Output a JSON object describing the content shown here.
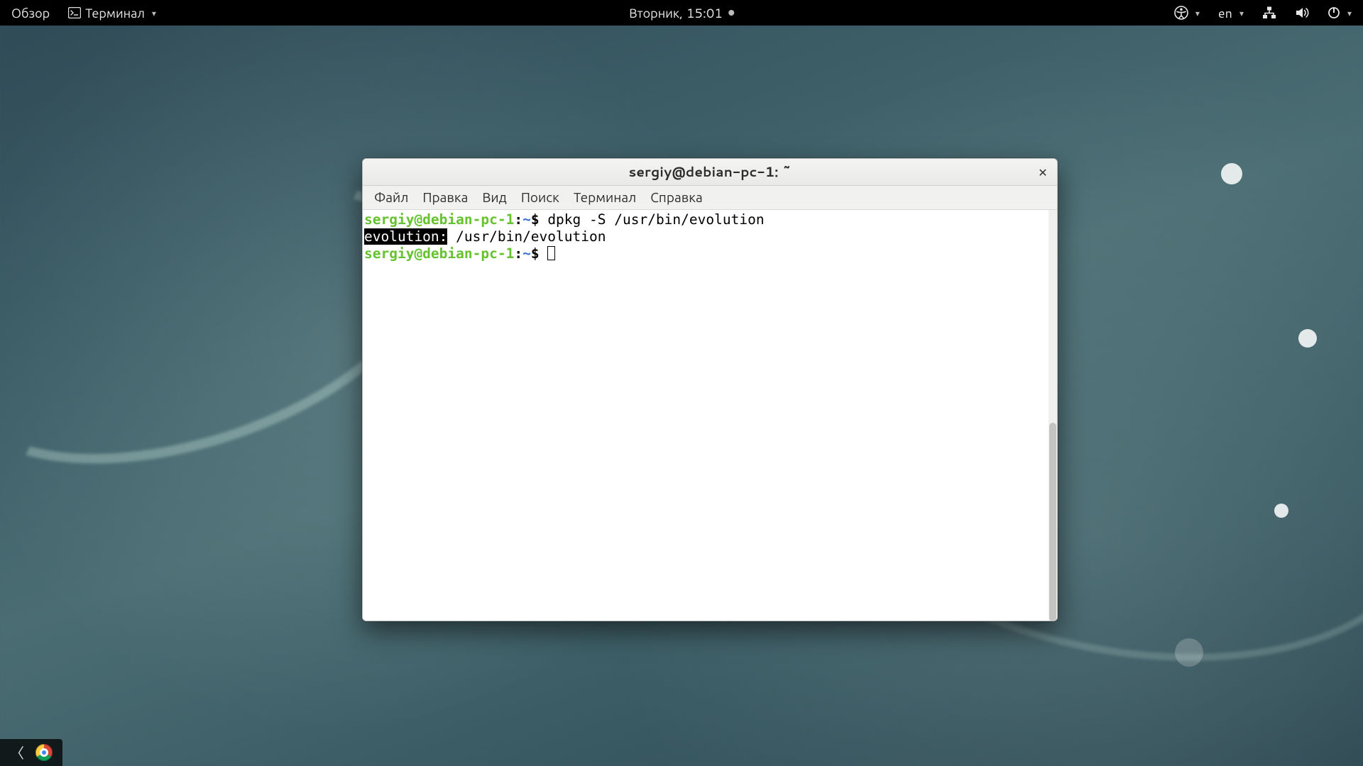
{
  "topbar": {
    "activities": "Обзор",
    "app_menu": "Терминал",
    "clock": "Вторник, 15:01",
    "lang": "en"
  },
  "window": {
    "title": "sergiy@debian-pc-1: ~",
    "menus": [
      "Файл",
      "Правка",
      "Вид",
      "Поиск",
      "Терминал",
      "Справка"
    ]
  },
  "terminal": {
    "prompt_userhost": "sergiy@debian-pc-1",
    "prompt_sep": ":",
    "prompt_path": "~",
    "prompt_symbol": "$",
    "line1_cmd": " dpkg -S /usr/bin/evolution",
    "line2_match": "evolution:",
    "line2_rest": " /usr/bin/evolution"
  }
}
